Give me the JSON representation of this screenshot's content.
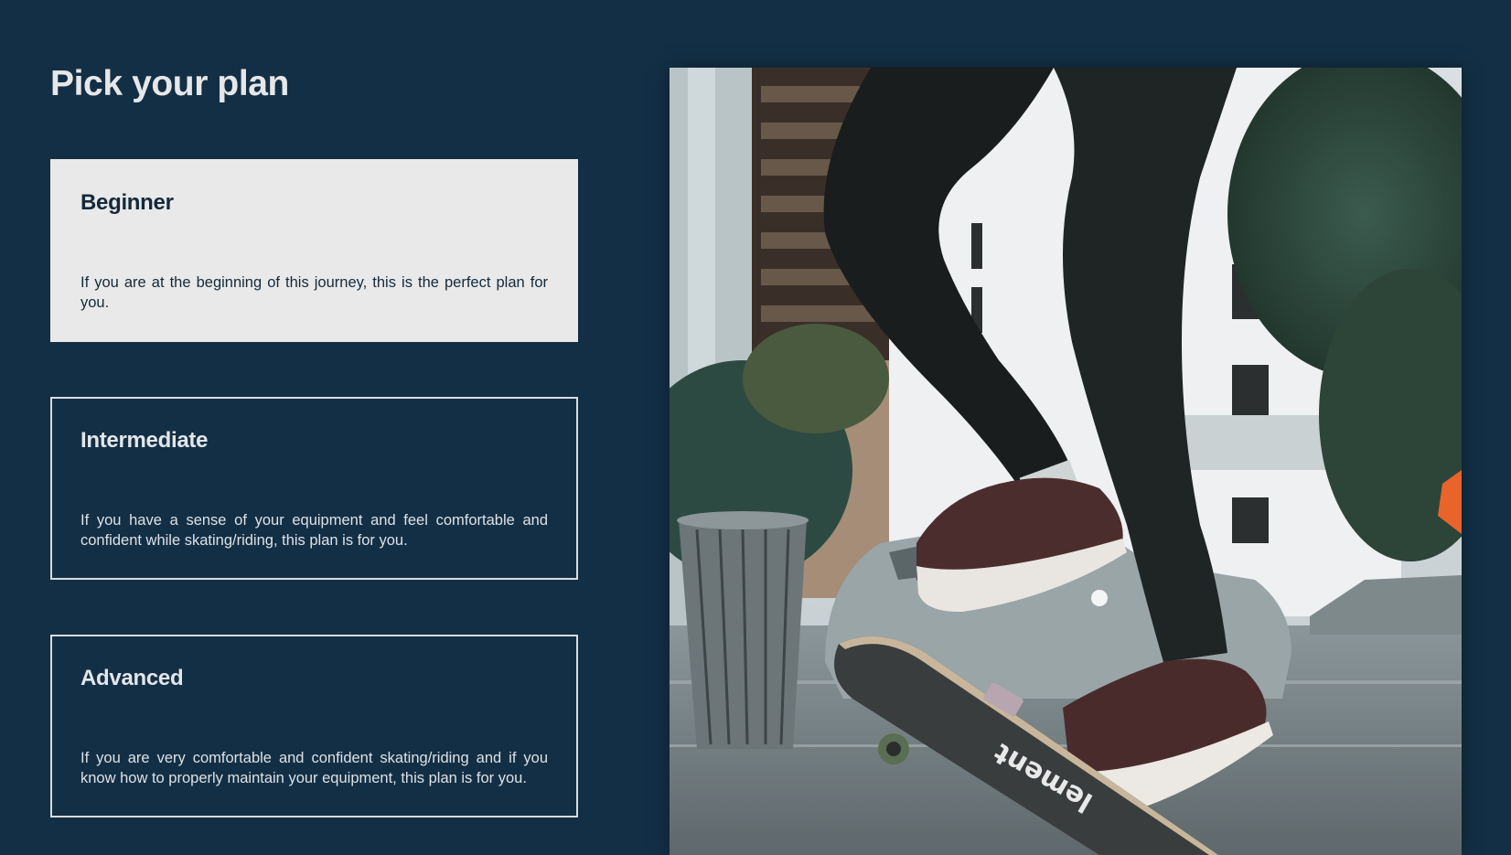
{
  "page": {
    "title": "Pick your plan"
  },
  "plans": [
    {
      "name": "Beginner",
      "description": "If you are at the beginning of this journey, this is the perfect plan for you.",
      "selected": true
    },
    {
      "name": "Intermediate",
      "description": "If you have a sense of your equipment and feel comfortable and confident while skating/riding, this plan is for you.",
      "selected": false
    },
    {
      "name": "Advanced",
      "description": "If you are very comfortable and confident skating/riding and if you know how to properly maintain your equipment, this plan is for you.",
      "selected": false
    }
  ],
  "hero": {
    "deck_text": "lement"
  },
  "colors": {
    "background": "#132f45",
    "card_selected": "#e9e9e9",
    "card_border": "#d6dbe0",
    "text_dark": "#15293a",
    "text_light": "#e6e7e9"
  }
}
